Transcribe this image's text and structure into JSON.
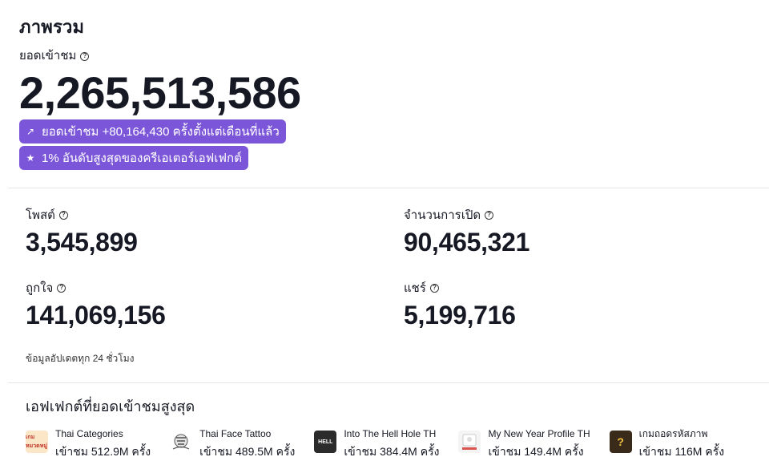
{
  "overview": {
    "title": "ภาพรวม",
    "views_label": "ยอดเข้าชม",
    "views_value": "2,265,513,586",
    "badges": [
      {
        "icon": "trend-up-icon",
        "glyph": "↗",
        "text": "ยอดเข้าชม +80,164,430 ครั้งตั้งแต่เดือนที่แล้ว"
      },
      {
        "icon": "star-icon",
        "glyph": "★",
        "text": "1% อันดับสูงสุดของครีเอเตอร์เอฟเฟกต์"
      }
    ]
  },
  "stats": {
    "posts": {
      "label": "โพสต์",
      "value": "3,545,899"
    },
    "opens": {
      "label": "จำนวนการเปิด",
      "value": "90,465,321"
    },
    "likes": {
      "label": "ถูกใจ",
      "value": "141,069,156"
    },
    "shares": {
      "label": "แชร์",
      "value": "5,199,716"
    },
    "update_note": "ข้อมูลอัปเดตทุก 24 ชั่วโมง"
  },
  "top_effects": {
    "title": "เอฟเฟกต์ที่ยอดเข้าชมสูงสุด",
    "items": [
      {
        "name": "Thai Categories",
        "views": "เข้าชม 512.9M ครั้ง",
        "thumb_text": "เกม หมวดหมู่",
        "thumb_bg": "#fbe6c8",
        "thumb_fg": "#c0392b"
      },
      {
        "name": "Thai Face Tattoo",
        "views": "เข้าชม 489.5M ครั้ง",
        "thumb_text": "",
        "thumb_bg": "#ffffff",
        "thumb_fg": "#333333"
      },
      {
        "name": "Into The Hell Hole TH",
        "views": "เข้าชม 384.4M ครั้ง",
        "thumb_text": "HELL",
        "thumb_bg": "#2b2b2b",
        "thumb_fg": "#ffffff"
      },
      {
        "name": "My New Year Profile TH",
        "views": "เข้าชม 149.4M ครั้ง",
        "thumb_text": "",
        "thumb_bg": "#f4f4f4",
        "thumb_fg": "#d9534f"
      },
      {
        "name": "เกมถอดรหัสภาพ",
        "views": "เข้าชม 116M ครั้ง",
        "thumb_text": "?",
        "thumb_bg": "#3a2a1a",
        "thumb_fg": "#f5c242"
      }
    ]
  },
  "colors": {
    "accent": "#7c56d9",
    "text": "#161823",
    "divider": "#e6e6e9"
  }
}
